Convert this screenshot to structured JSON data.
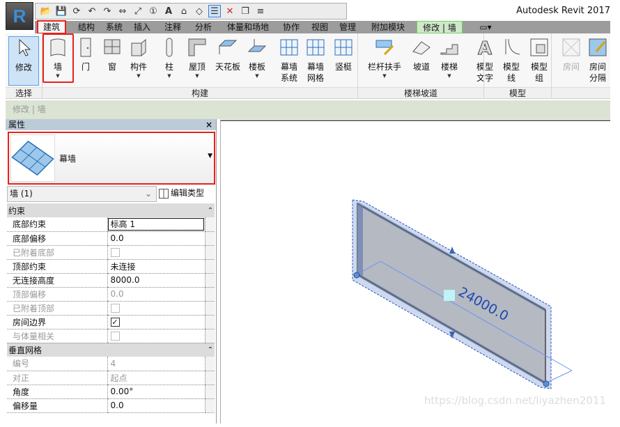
{
  "app": {
    "logo": "R",
    "title": "Autodesk Revit 2017"
  },
  "qat": {
    "icons": [
      "open-icon",
      "save-icon",
      "sync-icon",
      "undo-icon",
      "redo-icon",
      "measure-icon",
      "dimension-icon",
      "tag-icon",
      "text-icon",
      "3d-view-icon",
      "section-icon",
      "thin-lines-icon",
      "close-hidden-icon",
      "switch-windows-icon",
      "customize-icon"
    ]
  },
  "tabs": [
    "建筑",
    "结构",
    "系统",
    "插入",
    "注释",
    "分析",
    "体量和场地",
    "协作",
    "视图",
    "管理",
    "附加模块",
    "修改 | 墙"
  ],
  "ribbon": {
    "modify": "修改",
    "select": "选择",
    "build": [
      {
        "l1": "墙",
        "dd": true
      },
      {
        "l1": "门"
      },
      {
        "l1": "窗"
      },
      {
        "l1": "构件",
        "dd": true
      },
      {
        "l1": "柱",
        "dd": true
      },
      {
        "l1": "屋顶",
        "dd": true
      },
      {
        "l1": "天花板"
      },
      {
        "l1": "楼板",
        "dd": true
      },
      {
        "l1": "幕墙",
        "l2": "系统"
      },
      {
        "l1": "幕墙",
        "l2": "网格"
      },
      {
        "l1": "竖梃"
      }
    ],
    "build_label": "构建",
    "stairs": [
      {
        "l1": "栏杆扶手",
        "dd": true
      },
      {
        "l1": "坡道"
      },
      {
        "l1": "楼梯",
        "dd": true
      }
    ],
    "stairs_label": "楼梯坡道",
    "model": [
      {
        "l1": "模型",
        "l2": "文字"
      },
      {
        "l1": "模型",
        "l2": "线"
      },
      {
        "l1": "模型",
        "l2": "组"
      }
    ],
    "model_label": "模型",
    "room": [
      {
        "l1": "房间"
      },
      {
        "l1": "房间",
        "l2": "分隔"
      }
    ]
  },
  "context_bar": "修改 | 墙",
  "properties": {
    "title": "属性",
    "close": "×",
    "type_name": "幕墙",
    "instance": "墙 (1)",
    "edit_type": "编辑类型",
    "groups": [
      {
        "name": "约束",
        "rows": [
          {
            "label": "底部约束",
            "value": "标高 1"
          },
          {
            "label": "底部偏移",
            "value": "0.0"
          },
          {
            "label": "已附着底部",
            "check": false,
            "dim": true
          },
          {
            "label": "顶部约束",
            "value": "未连接"
          },
          {
            "label": "无连接高度",
            "value": "8000.0"
          },
          {
            "label": "顶部偏移",
            "value": "0.0",
            "dim": true
          },
          {
            "label": "已附着顶部",
            "check": false,
            "dim": true
          },
          {
            "label": "房间边界",
            "check": true
          },
          {
            "label": "与体量相关",
            "check": false,
            "dim": true
          }
        ]
      },
      {
        "name": "垂直网格",
        "rows": [
          {
            "label": "编号",
            "value": "4",
            "dim": true
          },
          {
            "label": "对正",
            "value": "起点",
            "dim": true
          },
          {
            "label": "角度",
            "value": "0.00°"
          },
          {
            "label": "偏移量",
            "value": "0.0"
          }
        ]
      }
    ]
  },
  "viewport": {
    "dimension": "24000.0"
  },
  "watermark": "https://blog.csdn.net/liyazhen2011",
  "colors": {
    "highlight": "#e8201a",
    "selection": "#1e50c8"
  }
}
